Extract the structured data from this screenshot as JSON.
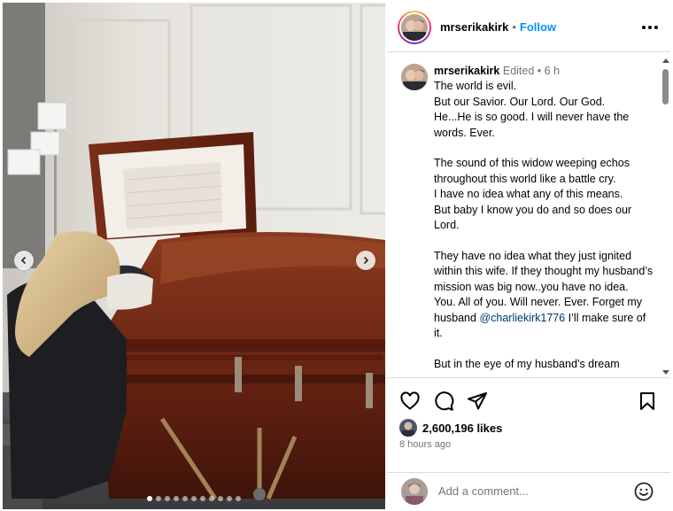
{
  "post": {
    "username": "mrserikakirk",
    "follow_label": "Follow",
    "separator": "•",
    "caption": {
      "edited_label": "Edited",
      "time_short": "6 h",
      "text_before_mention": "The world is evil.\nBut our Savior. Our Lord. Our God.\nHe...He is so good. I will never have the words. Ever.\n\nThe sound of this widow weeping echos throughout this world like a battle cry.\nI have no idea what any of this means.\nBut baby I know you do and so does our Lord.\n\nThey have no idea what they just ignited within this wife. If they thought my husband’s mission was big now..you have no idea.\nYou. All of you. Will never. Ever. Forget my husband ",
      "mention": "@charliekirk1776",
      "text_after_mention": " I’ll make sure of it.\n\nBut in the eye of my husband’s dream"
    },
    "likes": "2,600,196 likes",
    "time_ago": "8 hours ago",
    "comment_placeholder": "Add a comment...",
    "carousel": {
      "slide_count": 11,
      "active_index": 0
    }
  },
  "icons": {
    "like": "heart-icon",
    "comment": "comment-icon",
    "share": "share-icon",
    "save": "bookmark-icon",
    "more": "more-icon",
    "emoji": "emoji-icon",
    "prev": "chevron-left-icon",
    "next": "chevron-right-icon"
  },
  "colors": {
    "link_blue": "#0095f6",
    "mention": "#00376b",
    "muted": "#737373",
    "casket": "#6e2b17"
  }
}
